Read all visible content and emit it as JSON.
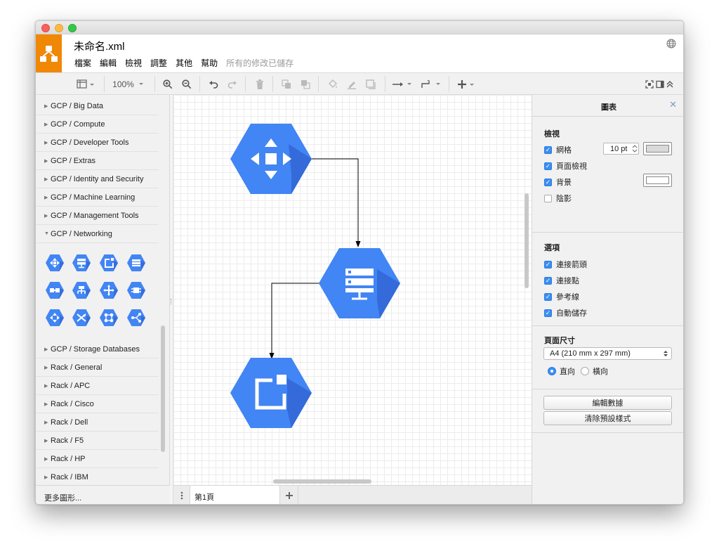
{
  "window": {
    "title": "未命名.xml"
  },
  "menu": [
    "檔案",
    "編輯",
    "檢視",
    "調整",
    "其他",
    "幫助"
  ],
  "status": "所有的修改已儲存",
  "toolbar": {
    "zoom": "100%"
  },
  "sidebar": {
    "categories_top": [
      {
        "label": "GCP / Big Data",
        "expanded": false
      },
      {
        "label": "GCP / Compute",
        "expanded": false
      },
      {
        "label": "GCP / Developer Tools",
        "expanded": false
      },
      {
        "label": "GCP / Extras",
        "expanded": false
      },
      {
        "label": "GCP / Identity and Security",
        "expanded": false
      },
      {
        "label": "GCP / Machine Learning",
        "expanded": false
      },
      {
        "label": "GCP / Management Tools",
        "expanded": false
      },
      {
        "label": "GCP / Networking",
        "expanded": true
      }
    ],
    "categories_bottom": [
      {
        "label": "GCP / Storage Databases",
        "expanded": false
      },
      {
        "label": "Rack / General",
        "expanded": false
      },
      {
        "label": "Rack / APC",
        "expanded": false
      },
      {
        "label": "Rack / Cisco",
        "expanded": false
      },
      {
        "label": "Rack / Dell",
        "expanded": false
      },
      {
        "label": "Rack / F5",
        "expanded": false
      },
      {
        "label": "Rack / HP",
        "expanded": false
      },
      {
        "label": "Rack / IBM",
        "expanded": false
      }
    ],
    "networking_shape_icons": [
      "cloud-load-balancing-icon",
      "cloud-dns-icon",
      "cloud-cdn-icon",
      "cloud-network-icon",
      "cloud-vpn-icon",
      "cloud-interconnect-icon",
      "cloud-router-icon",
      "cloud-routes-icon",
      "cloud-nat-icon",
      "traffic-director-icon",
      "network-topology-icon",
      "partner-interconnect-icon"
    ],
    "more_shapes": "更多圖形..."
  },
  "diagram": {
    "nodes": [
      {
        "name": "load-balancing-node",
        "icon": "cloud-load-balancing-icon"
      },
      {
        "name": "dns-node",
        "icon": "cloud-dns-icon"
      },
      {
        "name": "cdn-node",
        "icon": "cloud-cdn-icon"
      }
    ],
    "color": "#4285f4",
    "shadow_color": "#3367d6"
  },
  "pages": [
    {
      "label": "第1頁"
    }
  ],
  "format_panel": {
    "title": "圖表",
    "view": {
      "heading": "檢視",
      "grid": {
        "label": "網格",
        "checked": true,
        "size": "10 pt",
        "color": "#d9d9d9"
      },
      "page_view": {
        "label": "頁面檢視",
        "checked": true
      },
      "background": {
        "label": "背景",
        "checked": true,
        "color": "#ffffff"
      },
      "shadow": {
        "label": "陰影",
        "checked": false
      }
    },
    "options": {
      "heading": "選項",
      "items": [
        {
          "label": "連接箭頭",
          "checked": true
        },
        {
          "label": "連接點",
          "checked": true
        },
        {
          "label": "參考線",
          "checked": true
        },
        {
          "label": "自動儲存",
          "checked": true
        }
      ]
    },
    "page_size": {
      "heading": "頁面尺寸",
      "selected": "A4 (210 mm x 297 mm)",
      "orientation": {
        "portrait": "直向",
        "landscape": "橫向",
        "selected": "portrait"
      }
    },
    "buttons": {
      "edit_data": "編輯數據",
      "clear_style": "清除預設樣式"
    }
  },
  "colors": {
    "accent": "#f08705",
    "checkbox": "#3c8ef0",
    "node": "#4285f4"
  }
}
